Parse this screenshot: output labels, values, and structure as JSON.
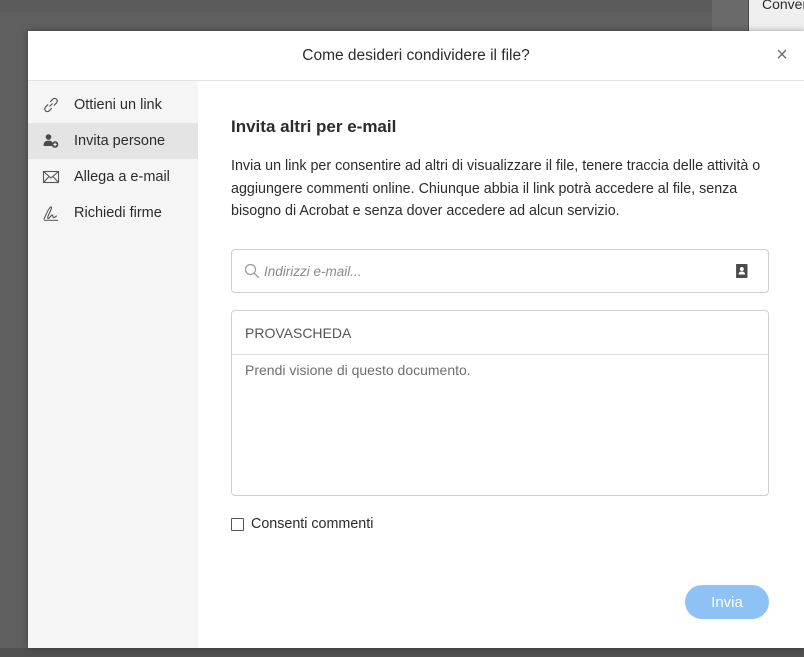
{
  "background": {
    "panel_text": "Conver"
  },
  "dialog": {
    "title": "Come desideri condividere il file?",
    "close_symbol": "×"
  },
  "sidebar": {
    "items": [
      {
        "label": "Ottieni un link",
        "icon": "link-icon",
        "active": false
      },
      {
        "label": "Invita persone",
        "icon": "add-person-icon",
        "active": true
      },
      {
        "label": "Allega a e-mail",
        "icon": "envelope-icon",
        "active": false
      },
      {
        "label": "Richiedi firme",
        "icon": "signature-icon",
        "active": false
      }
    ]
  },
  "main": {
    "heading": "Invita altri per e-mail",
    "description": "Invia un link per consentire ad altri di visualizzare il file, tenere traccia delle attività o aggiungere commenti online. Chiunque abbia il link potrà accedere al file, senza bisogno di Acrobat e senza dover accedere ad alcun servizio.",
    "email": {
      "placeholder": "Indirizzi e-mail...",
      "value": ""
    },
    "subject": {
      "value": "PROVASCHEDA"
    },
    "message": {
      "value": "Prendi visione di questo documento."
    },
    "allow_comments": {
      "label": "Consenti commenti",
      "checked": false
    },
    "send_label": "Invia"
  },
  "colors": {
    "accent": "#8ec2f4",
    "sidebar_bg": "#f5f5f5",
    "active_item_bg": "#e4e4e4"
  }
}
